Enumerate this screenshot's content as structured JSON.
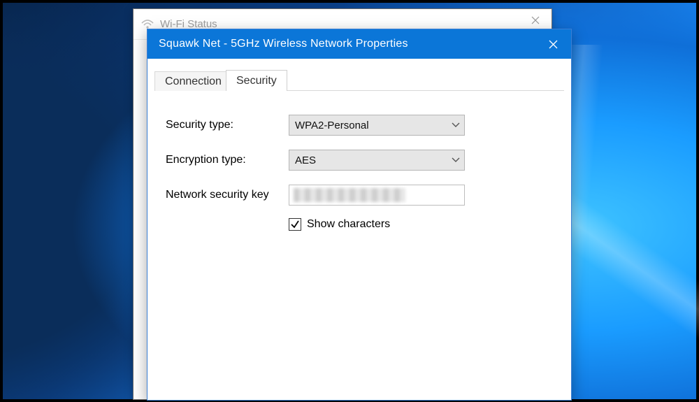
{
  "back_window": {
    "title": "Wi-Fi Status"
  },
  "window": {
    "title": "Squawk Net - 5GHz Wireless Network Properties"
  },
  "tabs": {
    "connection": "Connection",
    "security": "Security",
    "active": "security"
  },
  "fields": {
    "security_type_label": "Security type:",
    "security_type_value": "WPA2-Personal",
    "encryption_type_label": "Encryption type:",
    "encryption_type_value": "AES",
    "network_key_label": "Network security key",
    "network_key_value": "",
    "show_characters_label": "Show characters",
    "show_characters_checked": true
  }
}
